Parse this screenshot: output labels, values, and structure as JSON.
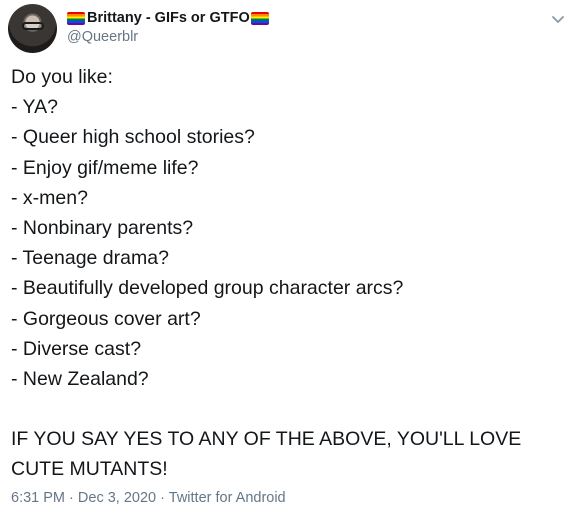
{
  "tweet": {
    "author": {
      "display_name": "Brittany - GIFs or GTFO",
      "handle": "@Queerblr",
      "flag_icon": "rainbow-flag-icon"
    },
    "more_icon": "chevron-down-icon",
    "body": {
      "intro": "Do you like:",
      "items": [
        "- YA?",
        "- Queer high school stories?",
        "- Enjoy gif/meme life?",
        "- x-men?",
        "- Nonbinary parents?",
        "- Teenage drama?",
        "- Beautifully developed group character arcs?",
        "- Gorgeous cover art?",
        "- Diverse cast?",
        "- New Zealand?"
      ],
      "cta_line1": "IF YOU SAY YES TO ANY OF THE ABOVE, YOU'LL LOVE",
      "cta_line2": "CUTE MUTANTS!"
    },
    "meta": {
      "time": "6:31 PM",
      "separator": "·",
      "date": "Dec 3, 2020",
      "source": "Twitter for Android"
    }
  }
}
